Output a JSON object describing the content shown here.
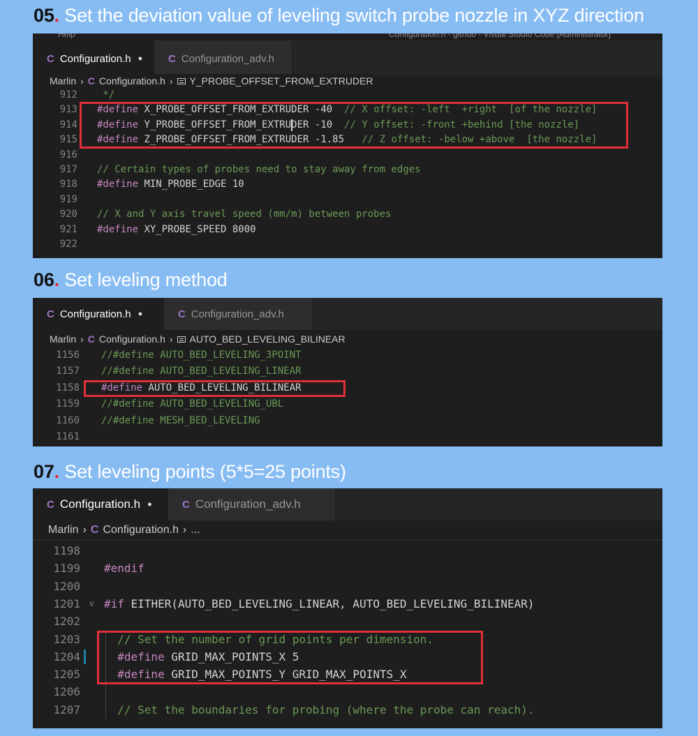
{
  "sections": [
    {
      "number": "05",
      "dot": ".",
      "title": "Set the deviation value of leveling switch probe nozzle in XYZ direction",
      "window_title": "Help",
      "window_title_right": "Configuration.h - github - Visual Studio Code [Administrator]",
      "tabs": [
        {
          "icon": "C",
          "label": "Configuration.h",
          "dirty": "●"
        },
        {
          "icon": "C",
          "label": "Configuration_adv.h"
        }
      ],
      "breadcrumb": {
        "root": "Marlin",
        "file": "Configuration.h",
        "symbol": "Y_PROBE_OFFSET_FROM_EXTRUDER"
      },
      "lines": [
        {
          "n": "912",
          "parts": [
            {
              "t": " */",
              "c": "cm"
            }
          ]
        },
        {
          "n": "913",
          "parts": [
            {
              "t": "#define",
              "c": "kw"
            },
            {
              "t": " X_PROBE_OFFSET_FROM_EXTRUDER ",
              "c": "pl"
            },
            {
              "t": "-40",
              "c": "pl"
            },
            {
              "t": "  // X offset: -left  +right  [of the nozzle]",
              "c": "cm"
            }
          ]
        },
        {
          "n": "914",
          "parts": [
            {
              "t": "#define",
              "c": "kw"
            },
            {
              "t": " Y_PROBE_OFFSET_FROM_EXTRUDER ",
              "c": "pl"
            },
            {
              "t": "-10",
              "c": "pl"
            },
            {
              "t": "  // Y offset: -front +behind [the nozzle]",
              "c": "cm"
            }
          ]
        },
        {
          "n": "915",
          "parts": [
            {
              "t": "#define",
              "c": "kw"
            },
            {
              "t": " Z_PROBE_OFFSET_FROM_EXTRUDER ",
              "c": "pl"
            },
            {
              "t": "-1.85",
              "c": "pl"
            },
            {
              "t": "   // Z offset: -below +above  [the nozzle]",
              "c": "cm"
            }
          ]
        },
        {
          "n": "916",
          "parts": []
        },
        {
          "n": "917",
          "parts": [
            {
              "t": "// Certain types of probes need to stay away from edges",
              "c": "cm"
            }
          ]
        },
        {
          "n": "918",
          "parts": [
            {
              "t": "#define",
              "c": "kw"
            },
            {
              "t": " MIN_PROBE_EDGE 10",
              "c": "pl"
            }
          ]
        },
        {
          "n": "919",
          "parts": []
        },
        {
          "n": "920",
          "parts": [
            {
              "t": "// X and Y axis travel speed (mm/m) between probes",
              "c": "cm"
            }
          ]
        },
        {
          "n": "921",
          "parts": [
            {
              "t": "#define",
              "c": "kw"
            },
            {
              "t": " XY_PROBE_SPEED 8000",
              "c": "pl"
            }
          ]
        },
        {
          "n": "922",
          "parts": []
        }
      ]
    },
    {
      "number": "06",
      "dot": ".",
      "title": "Set leveling method",
      "tabs": [
        {
          "icon": "C",
          "label": "Configuration.h",
          "dirty": "●"
        },
        {
          "icon": "C",
          "label": "Configuration_adv.h"
        }
      ],
      "breadcrumb": {
        "root": "Marlin",
        "file": "Configuration.h",
        "symbol": "AUTO_BED_LEVELING_BILINEAR"
      },
      "lines": [
        {
          "n": "1156",
          "parts": [
            {
              "t": "//#define AUTO_BED_LEVELING_3POINT",
              "c": "cm"
            }
          ]
        },
        {
          "n": "1157",
          "parts": [
            {
              "t": "//#define AUTO_BED_LEVELING_LINEAR",
              "c": "cm"
            }
          ]
        },
        {
          "n": "1158",
          "parts": [
            {
              "t": "#define",
              "c": "kw"
            },
            {
              "t": " AUTO_BED_LEVELING_BILINEAR",
              "c": "pl"
            }
          ]
        },
        {
          "n": "1159",
          "parts": [
            {
              "t": "//#define AUTO_BED_LEVELING_UBL",
              "c": "cm"
            }
          ]
        },
        {
          "n": "1160",
          "parts": [
            {
              "t": "//#define MESH_BED_LEVELING",
              "c": "cm"
            }
          ]
        },
        {
          "n": "1161",
          "parts": []
        }
      ]
    },
    {
      "number": "07",
      "dot": ".",
      "title": "Set leveling points (5*5=25 points)",
      "tabs": [
        {
          "icon": "C",
          "label": "Configuration.h",
          "dirty": "●"
        },
        {
          "icon": "C",
          "label": "Configuration_adv.h"
        }
      ],
      "breadcrumb": {
        "root": "Marlin",
        "file": "Configuration.h",
        "symbol": "..."
      },
      "lines": [
        {
          "n": "1198",
          "parts": []
        },
        {
          "n": "1199",
          "parts": [
            {
              "t": "#endif",
              "c": "kw"
            }
          ]
        },
        {
          "n": "1200",
          "parts": []
        },
        {
          "n": "1201",
          "parts": [
            {
              "t": "#if",
              "c": "kw"
            },
            {
              "t": " EITHER(AUTO_BED_LEVELING_LINEAR, AUTO_BED_LEVELING_BILINEAR)",
              "c": "pl"
            }
          ]
        },
        {
          "n": "1202",
          "parts": []
        },
        {
          "n": "1203",
          "parts": [
            {
              "t": "  // Set the number of grid points per dimension.",
              "c": "cm"
            }
          ]
        },
        {
          "n": "1204",
          "parts": [
            {
              "t": "  #define",
              "c": "kw"
            },
            {
              "t": " GRID_MAX_POINTS_X 5",
              "c": "pl"
            }
          ]
        },
        {
          "n": "1205",
          "parts": [
            {
              "t": "  #define",
              "c": "kw"
            },
            {
              "t": " GRID_MAX_POINTS_Y GRID_MAX_POINTS_X",
              "c": "pl"
            }
          ]
        },
        {
          "n": "1206",
          "parts": []
        },
        {
          "n": "1207",
          "parts": [
            {
              "t": "  // Set the boundaries for probing (where the probe can reach).",
              "c": "cm"
            }
          ]
        }
      ]
    }
  ],
  "colors": {
    "background": "#87bcf3",
    "editor_bg": "#1e1e1e",
    "highlight_box": "#e0303a",
    "keyword": "#c586c0",
    "comment": "#6a9955"
  }
}
